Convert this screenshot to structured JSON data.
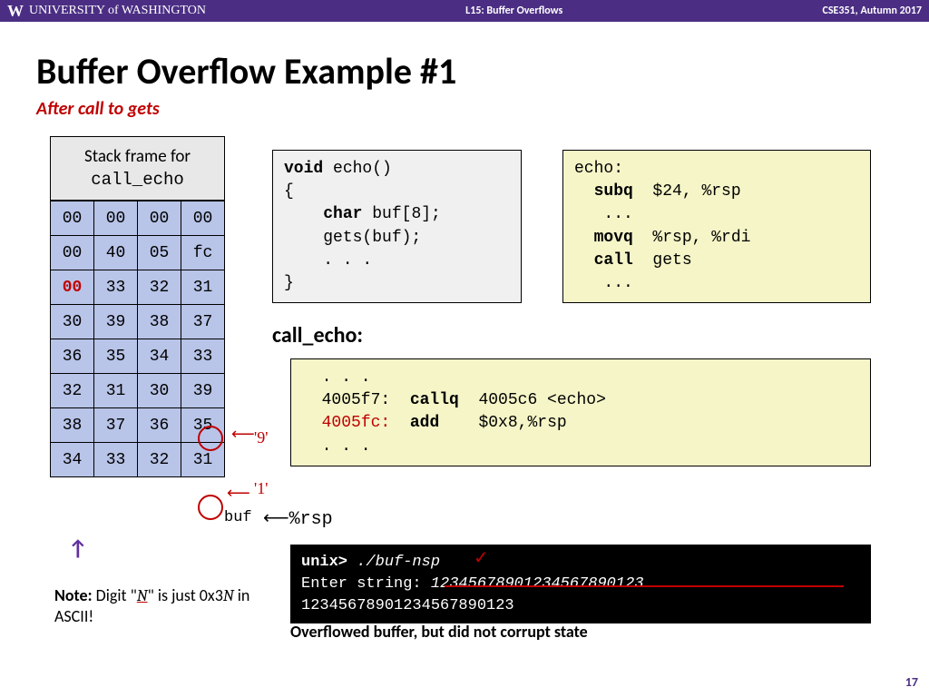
{
  "header": {
    "logo_w": "W",
    "logo_text": "UNIVERSITY of WASHINGTON",
    "center": "L15: Buffer Overflows",
    "right": "CSE351, Autumn 2017"
  },
  "title": "Buffer Overflow Example #1",
  "subtitle": "After call to gets",
  "stack_header_line1": "Stack frame for",
  "stack_header_line2": "call_echo",
  "stack_rows": [
    [
      "00",
      "00",
      "00",
      "00"
    ],
    [
      "00",
      "40",
      "05",
      "fc"
    ],
    [
      "00",
      "33",
      "32",
      "31"
    ],
    [
      "30",
      "39",
      "38",
      "37"
    ],
    [
      "36",
      "35",
      "34",
      "33"
    ],
    [
      "32",
      "31",
      "30",
      "39"
    ],
    [
      "38",
      "37",
      "36",
      "35"
    ],
    [
      "34",
      "33",
      "32",
      "31"
    ]
  ],
  "red_cell": {
    "row": 2,
    "col": 0
  },
  "code1": {
    "l1_a": "void",
    "l1_b": " echo()",
    "l2": "{",
    "l3_a": "    ",
    "l3_b": "char",
    "l3_c": " buf[8];",
    "l4": "    gets(buf);",
    "l5": "    . . .",
    "l6": "}"
  },
  "code2": {
    "l1": "echo:",
    "l2_a": "  ",
    "l2_b": "subq",
    "l2_c": "  $24, %rsp",
    "l3": "   ...",
    "l4_a": "  ",
    "l4_b": "movq",
    "l4_c": "  %rsp, %rdi",
    "l5_a": "  ",
    "l5_b": "call",
    "l5_c": "  gets",
    "l6": "   ..."
  },
  "call_label": "call_echo:",
  "code3": {
    "l1": "  . . .",
    "l2_a": "  4005f7:  ",
    "l2_b": "callq",
    "l2_c": "  4005c6 <echo>",
    "l3_a": "  ",
    "l3_b": "4005fc:",
    "l3_c": "  ",
    "l3_d": "add",
    "l3_e": "    $0x8,%rsp",
    "l4": "  . . ."
  },
  "terminal": {
    "prompt": "unix>",
    "cmd": " ./buf-nsp",
    "l2": "Enter string: ",
    "input": "12345678901234567890123",
    "l3": "12345678901234567890123"
  },
  "overflow_msg": "Overflowed buffer, but did not corrupt state",
  "buf_label": "buf",
  "rsp_label": "⟵%rsp",
  "note_bold": "Note:",
  "note_text": "  Digit \"",
  "note_var": "N",
  "note_text2": "\" is just 0x3",
  "note_var2": "N",
  "note_text3": " in ASCII!",
  "page_num": "17",
  "annotations": {
    "nine": "'9'",
    "one": "'1'"
  }
}
